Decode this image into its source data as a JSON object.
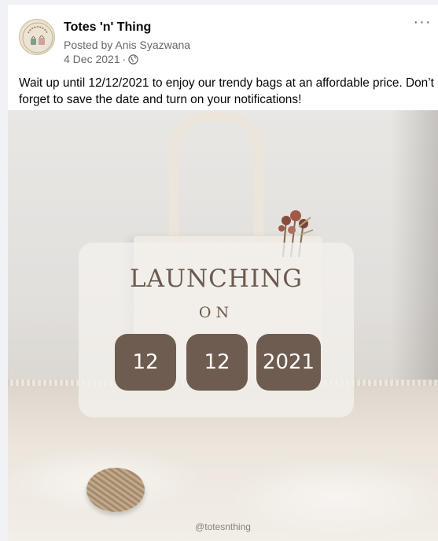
{
  "post": {
    "page_name": "Totes 'n' Thing",
    "posted_by": "Posted by Anis Syazwana",
    "date": "4 Dec 2021",
    "separator": "·",
    "privacy_icon": "globe-icon",
    "more_icon": "ellipsis-icon",
    "caption": "Wait up until 12/12/2021 to enjoy our trendy bags at an affordable price. Don’t forget to save the date and turn on your notifications!"
  },
  "avatar": {
    "logo_text": "Totes 'n' thing"
  },
  "image": {
    "headline": "LAUNCHING",
    "subline": "ON",
    "date_day": "12",
    "date_month": "12",
    "date_year": "2021",
    "handle": "@totesnthing"
  },
  "colors": {
    "accent_brown": "#6f5c50",
    "headline_brown": "#6b5a4e",
    "secondary_text": "#65676b"
  }
}
